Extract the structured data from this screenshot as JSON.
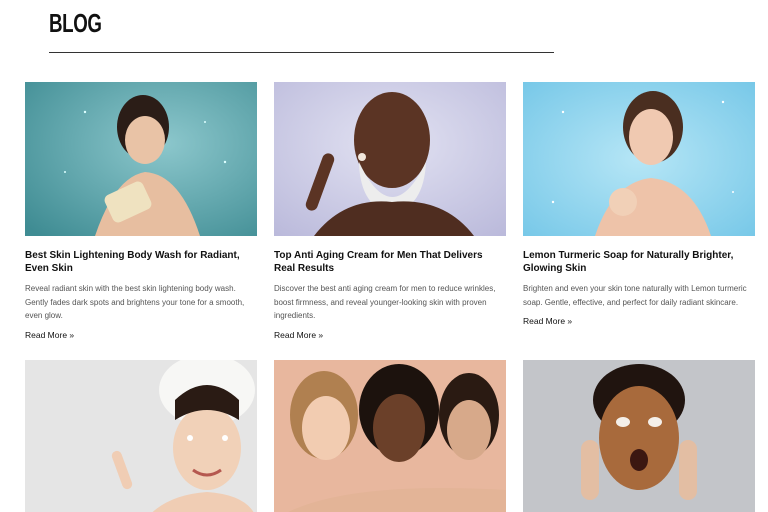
{
  "page": {
    "title": "BLOG"
  },
  "posts": [
    {
      "title": "Best Skin Lightening Body Wash for Radiant, Even Skin",
      "excerpt": "Reveal radiant skin with the best skin lightening body wash. Gently fades dark spots and brightens your tone for a smooth, even glow.",
      "read_more": "Read More »"
    },
    {
      "title": "Top Anti Aging Cream for Men That Delivers Real Results",
      "excerpt": "Discover the best anti aging cream for men to reduce wrinkles, boost firmness, and reveal younger-looking skin with proven ingredients.",
      "read_more": "Read More »"
    },
    {
      "title": "Lemon Turmeric Soap for Naturally Brighter, Glowing Skin",
      "excerpt": "Brighten and even your skin tone naturally with Lemon turmeric soap. Gentle, effective, and perfect for daily radiant skincare.",
      "read_more": "Read More »"
    }
  ],
  "colors": {
    "rule": "#333333",
    "teal_bg": "#5fa7ad",
    "lavender_bg": "#c9c9e4",
    "sky_bg": "#8fd3ee",
    "grey_bg": "#e6e6e6",
    "peach_bg": "#eab89f",
    "slate_bg": "#b9bcc1"
  }
}
